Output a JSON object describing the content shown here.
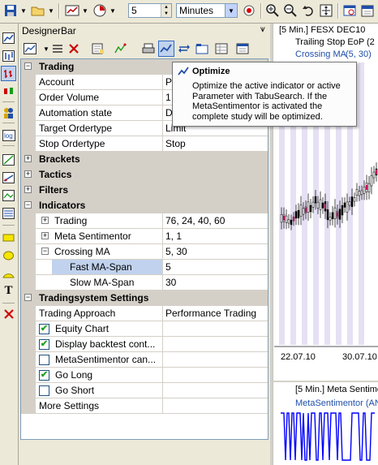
{
  "toolbar": {
    "bar_count": "5",
    "timeframe": "Minutes"
  },
  "panel": {
    "title": "DesignerBar",
    "pin_icon": "pin-icon"
  },
  "grid": {
    "trading_category": "Trading",
    "account_label": "Account",
    "account_value": "P",
    "order_volume_label": "Order Volume",
    "order_volume_value": "1",
    "automation_state_label": "Automation state",
    "automation_state_value": "D",
    "target_ordertype_label": "Target Ordertype",
    "target_ordertype_value": "Limit",
    "stop_ordertype_label": "Stop Ordertype",
    "stop_ordertype_value": "Stop",
    "brackets_category": "Brackets",
    "tactics_category": "Tactics",
    "filters_category": "Filters",
    "indicators_category": "Indicators",
    "ind_trading_label": "Trading",
    "ind_trading_value": "76, 24, 40, 60",
    "meta_sentimentor_label": "Meta Sentimentor",
    "meta_sentimentor_value": "1, 1",
    "crossing_ma_label": "Crossing MA",
    "crossing_ma_value": "5, 30",
    "fast_ma_label": "Fast MA-Span",
    "fast_ma_value": "5",
    "slow_ma_label": "Slow MA-Span",
    "slow_ma_value": "30",
    "tradingsystem_category": "Tradingsystem Settings",
    "trading_approach_label": "Trading Approach",
    "trading_approach_value": "Performance Trading",
    "equity_chart_label": "Equity Chart",
    "display_backtest_label": "Display backtest cont...",
    "metasentimentor_can_label": "MetaSentimentor can...",
    "go_long_label": "Go Long",
    "go_short_label": "Go Short",
    "more_settings_label": "More Settings",
    "equity_chart_checked": true,
    "display_backtest_checked": true,
    "metasentimentor_can_checked": false,
    "go_long_checked": true,
    "go_short_checked": false
  },
  "tooltip": {
    "title": "Optimize",
    "body": "Optimize the active indicator or active Parameter with TabuSearch. If the MetaSentimentor is activated the complete study will be optimized."
  },
  "chart": {
    "header": "[5 Min.] FESX DEC10",
    "legend1": "Trailing Stop EoP",
    "legend1_value": "(2",
    "legend2": "Crossing MA",
    "legend2_value": "(5, 30)",
    "date1": "22.07.10",
    "date2": "30.07.10",
    "lower_header": "[5 Min.] Meta Sentimen",
    "lower_legend": "MetaSentimentor (ANN",
    "accent_blue": "#0000ff",
    "band_color": "#e6e0f4"
  }
}
